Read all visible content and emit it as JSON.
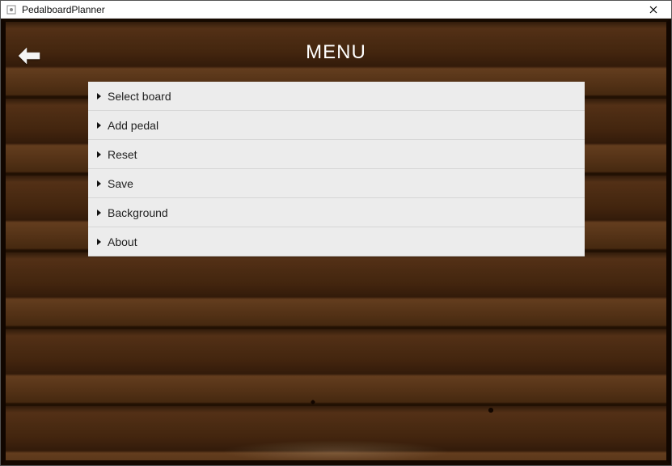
{
  "window": {
    "title": "PedalboardPlanner"
  },
  "header": {
    "title": "MENU"
  },
  "menu": {
    "items": [
      {
        "label": "Select board"
      },
      {
        "label": "Add pedal"
      },
      {
        "label": "Reset"
      },
      {
        "label": "Save"
      },
      {
        "label": "Background"
      },
      {
        "label": "About"
      }
    ]
  }
}
